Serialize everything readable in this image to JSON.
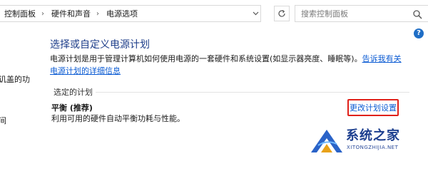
{
  "address_bar": {
    "breadcrumbs": [
      "控制面板",
      "硬件和声音",
      "电源选项"
    ],
    "separator": "›"
  },
  "search": {
    "placeholder": "搜索控制面板"
  },
  "sidebar_partial": {
    "line1": "讥盖的功",
    "line2": "间"
  },
  "main": {
    "title": "选择或自定义电源计划",
    "description": "电源计划是用于管理计算机如何使用电源的一套硬件和系统设置(如显示器亮度、睡眠等)。",
    "description_link": "告诉我有关电源计划的详细信息",
    "section_label": "选定的计划",
    "plan_name": "平衡 (推荐)",
    "plan_description": "利用可用的硬件自动平衡功耗与性能。",
    "change_link": "更改计划设置"
  },
  "watermark": {
    "text": "系统之家",
    "url": "XITONGZHIJIA.NET"
  },
  "colors": {
    "title": "#1e3e8a",
    "link": "#0b5bd3",
    "highlight_border": "#e0211a"
  }
}
